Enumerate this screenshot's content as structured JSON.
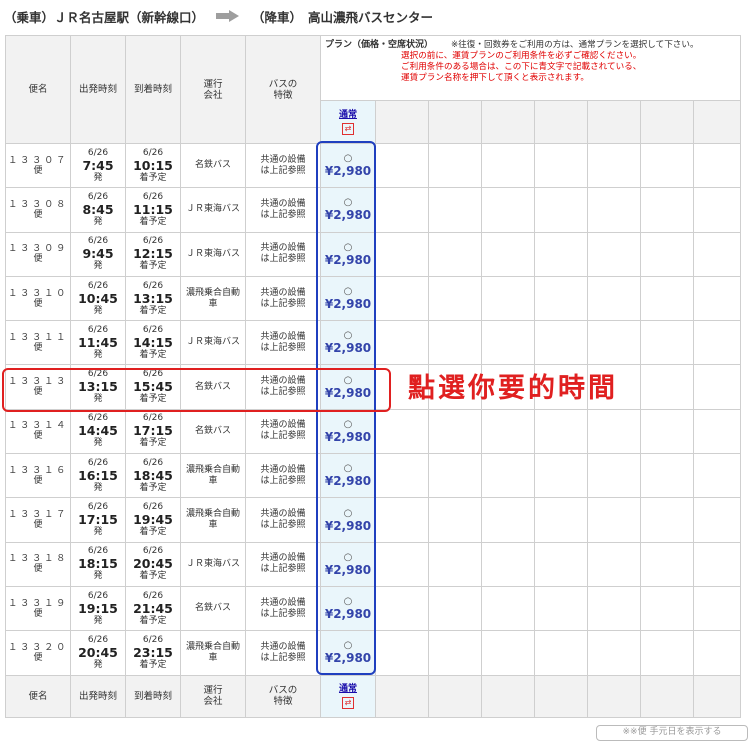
{
  "route": {
    "boarding_label": "（乗車）",
    "boarding_stop": "ＪＲ名古屋駅（新幹線口）",
    "alighting_label": "（降車）",
    "alighting_stop": "高山濃飛バスセンター"
  },
  "header": {
    "col_bus": "便名",
    "col_depart": "出発時刻",
    "col_arrive": "到着時刻",
    "col_operator": "運行\n会社",
    "col_feature": "バスの\n特徴",
    "plan_title": "プラン（価格・空席状況）",
    "plan_note": "※往復・回数券をご利用の方は、通常プランを選択して下さい。",
    "red_notice": [
      "選択の前に、運賃プランのご利用条件を必ずご確認ください。",
      "ご利用条件のある場合は、この下に青文字で記載されている、",
      "運賃プラン名称を押下して頂くと表示されます。"
    ],
    "plan_name": "通常",
    "plan_swap_icon": "swap-icon"
  },
  "rows": [
    {
      "bus": "１３３０７",
      "bin": "便",
      "dep_date": "6/26",
      "dep_time": "7:45",
      "dep_suffix": "発",
      "arr_date": "6/26",
      "arr_time": "10:15",
      "arr_suffix": "着予定",
      "operator": "名鉄バス",
      "feature": "共通の設備\nは上記参照",
      "mark": "○",
      "price": "¥2,980"
    },
    {
      "bus": "１３３０８",
      "bin": "便",
      "dep_date": "6/26",
      "dep_time": "8:45",
      "dep_suffix": "発",
      "arr_date": "6/26",
      "arr_time": "11:15",
      "arr_suffix": "着予定",
      "operator": "ＪＲ東海バス",
      "feature": "共通の設備\nは上記参照",
      "mark": "○",
      "price": "¥2,980"
    },
    {
      "bus": "１３３０９",
      "bin": "便",
      "dep_date": "6/26",
      "dep_time": "9:45",
      "dep_suffix": "発",
      "arr_date": "6/26",
      "arr_time": "12:15",
      "arr_suffix": "着予定",
      "operator": "ＪＲ東海バス",
      "feature": "共通の設備\nは上記参照",
      "mark": "○",
      "price": "¥2,980"
    },
    {
      "bus": "１３３１０",
      "bin": "便",
      "dep_date": "6/26",
      "dep_time": "10:45",
      "dep_suffix": "発",
      "arr_date": "6/26",
      "arr_time": "13:15",
      "arr_suffix": "着予定",
      "operator": "濃飛乗合自動\n車",
      "feature": "共通の設備\nは上記参照",
      "mark": "○",
      "price": "¥2,980"
    },
    {
      "bus": "１３３１１",
      "bin": "便",
      "dep_date": "6/26",
      "dep_time": "11:45",
      "dep_suffix": "発",
      "arr_date": "6/26",
      "arr_time": "14:15",
      "arr_suffix": "着予定",
      "operator": "ＪＲ東海バス",
      "feature": "共通の設備\nは上記参照",
      "mark": "○",
      "price": "¥2,980"
    },
    {
      "bus": "１３３１３",
      "bin": "便",
      "dep_date": "6/26",
      "dep_time": "13:15",
      "dep_suffix": "発",
      "arr_date": "6/26",
      "arr_time": "15:45",
      "arr_suffix": "着予定",
      "operator": "名鉄バス",
      "feature": "共通の設備\nは上記参照",
      "mark": "○",
      "price": "¥2,980"
    },
    {
      "bus": "１３３１４",
      "bin": "便",
      "dep_date": "6/26",
      "dep_time": "14:45",
      "dep_suffix": "発",
      "arr_date": "6/26",
      "arr_time": "17:15",
      "arr_suffix": "着予定",
      "operator": "名鉄バス",
      "feature": "共通の設備\nは上記参照",
      "mark": "○",
      "price": "¥2,980"
    },
    {
      "bus": "１３３１６",
      "bin": "便",
      "dep_date": "6/26",
      "dep_time": "16:15",
      "dep_suffix": "発",
      "arr_date": "6/26",
      "arr_time": "18:45",
      "arr_suffix": "着予定",
      "operator": "濃飛乗合自動\n車",
      "feature": "共通の設備\nは上記参照",
      "mark": "○",
      "price": "¥2,980"
    },
    {
      "bus": "１３３１７",
      "bin": "便",
      "dep_date": "6/26",
      "dep_time": "17:15",
      "dep_suffix": "発",
      "arr_date": "6/26",
      "arr_time": "19:45",
      "arr_suffix": "着予定",
      "operator": "濃飛乗合自動\n車",
      "feature": "共通の設備\nは上記参照",
      "mark": "○",
      "price": "¥2,980"
    },
    {
      "bus": "１３３１８",
      "bin": "便",
      "dep_date": "6/26",
      "dep_time": "18:15",
      "dep_suffix": "発",
      "arr_date": "6/26",
      "arr_time": "20:45",
      "arr_suffix": "着予定",
      "operator": "ＪＲ東海バス",
      "feature": "共通の設備\nは上記参照",
      "mark": "○",
      "price": "¥2,980"
    },
    {
      "bus": "１３３１９",
      "bin": "便",
      "dep_date": "6/26",
      "dep_time": "19:15",
      "dep_suffix": "発",
      "arr_date": "6/26",
      "arr_time": "21:45",
      "arr_suffix": "着予定",
      "operator": "名鉄バス",
      "feature": "共通の設備\nは上記参照",
      "mark": "○",
      "price": "¥2,980"
    },
    {
      "bus": "１３３２０",
      "bin": "便",
      "dep_date": "6/26",
      "dep_time": "20:45",
      "dep_suffix": "発",
      "arr_date": "6/26",
      "arr_time": "23:15",
      "arr_suffix": "着予定",
      "operator": "濃飛乗合自動\n車",
      "feature": "共通の設備\nは上記参照",
      "mark": "○",
      "price": "¥2,980"
    }
  ],
  "annotation": "點選你要的時間",
  "bottom_button": "※※便 手元日を表示する",
  "colors": {
    "highlight_blue": "#1f3fbf",
    "highlight_red": "#e02020",
    "price_text": "#3344aa",
    "price_bg": "#eaf6fb",
    "notice_red": "#e00000"
  }
}
